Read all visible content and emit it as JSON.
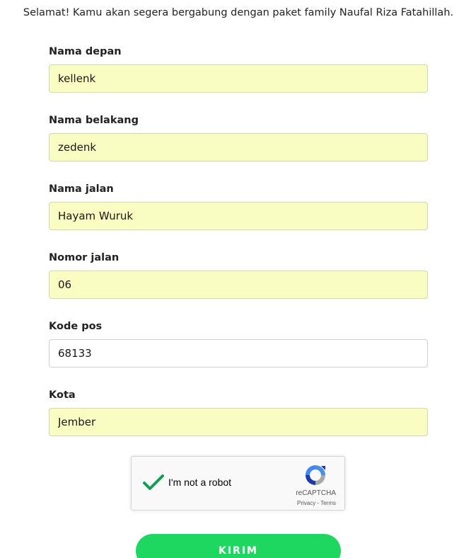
{
  "intro_text": "Selamat! Kamu akan segera bergabung dengan paket family Naufal Riza Fatahillah.",
  "form": {
    "fields": [
      {
        "label": "Nama depan",
        "value": "kellenk",
        "autofilled": true
      },
      {
        "label": "Nama belakang",
        "value": "zedenk",
        "autofilled": true
      },
      {
        "label": "Nama jalan",
        "value": "Hayam Wuruk",
        "autofilled": true
      },
      {
        "label": "Nomor jalan",
        "value": "06",
        "autofilled": true
      },
      {
        "label": "Kode pos",
        "value": "68133",
        "autofilled": false
      },
      {
        "label": "Kota",
        "value": "Jember",
        "autofilled": true
      }
    ],
    "autofill_color": "#fafdc1"
  },
  "captcha": {
    "label": "I'm not a robot",
    "checked": true,
    "check_color": "#0f9d58",
    "brand": "reCAPTCHA",
    "privacy": "Privacy",
    "separator": " - ",
    "terms": "Terms",
    "logo_icon": "recaptcha-logo-icon"
  },
  "submit": {
    "label": "KIRIM",
    "color": "#1ed760"
  }
}
